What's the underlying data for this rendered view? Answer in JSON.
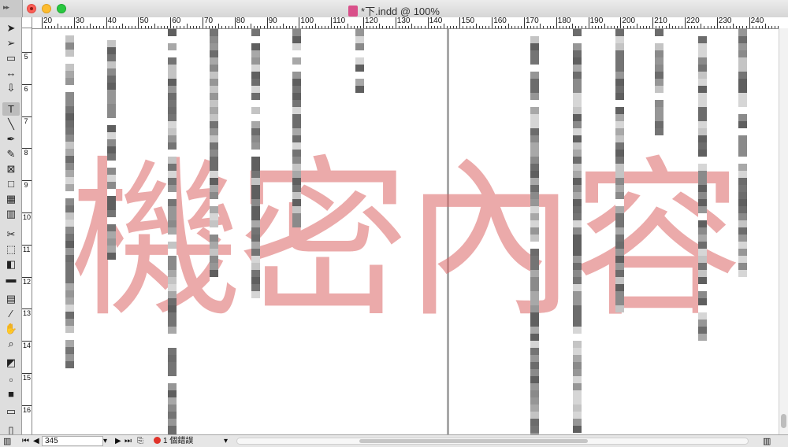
{
  "window": {
    "title": "*下.indd @ 100%",
    "buttons": [
      "close",
      "minimize",
      "zoom"
    ]
  },
  "colors": {
    "watermark": "#db6464",
    "close": "#fc5f57",
    "minimize": "#fdbc2f",
    "zoom": "#29c840",
    "preflight_error": "#e0332a"
  },
  "ruler": {
    "horizontal_labels": [
      "20",
      "30",
      "40",
      "50",
      "60",
      "70",
      "80",
      "90",
      "100",
      "110",
      "120",
      "130",
      "140",
      "150",
      "160",
      "170",
      "180",
      "190",
      "200",
      "210",
      "220",
      "230",
      "240"
    ],
    "vertical_labels": [
      "5",
      "6",
      "7",
      "8",
      "9",
      "10",
      "11",
      "12",
      "13",
      "14",
      "15",
      "16"
    ]
  },
  "toolbox": {
    "tools": [
      {
        "name": "selection-tool",
        "glyph": "➤"
      },
      {
        "name": "direct-selection-tool",
        "glyph": "➢"
      },
      {
        "name": "page-tool",
        "glyph": "▭"
      },
      {
        "name": "gap-tool",
        "glyph": "↔"
      },
      {
        "name": "content-collector-tool",
        "glyph": "⇩"
      },
      {
        "name": "type-tool",
        "glyph": "T"
      },
      {
        "name": "line-tool",
        "glyph": "╲"
      },
      {
        "name": "pen-tool",
        "glyph": "✒"
      },
      {
        "name": "pencil-tool",
        "glyph": "✎"
      },
      {
        "name": "rectangle-frame-tool",
        "glyph": "⊠"
      },
      {
        "name": "rectangle-tool",
        "glyph": "□"
      },
      {
        "name": "table-tool",
        "glyph": "▦"
      },
      {
        "name": "grid-tool",
        "glyph": "▥"
      },
      {
        "name": "scissors-tool",
        "glyph": "✂"
      },
      {
        "name": "free-transform-tool",
        "glyph": "⬚"
      },
      {
        "name": "gradient-swatch-tool",
        "glyph": "◧"
      },
      {
        "name": "gradient-feather-tool",
        "glyph": "▬"
      },
      {
        "name": "note-tool",
        "glyph": "▤"
      },
      {
        "name": "eyedropper-tool",
        "glyph": "⁄"
      },
      {
        "name": "hand-tool",
        "glyph": "✋"
      },
      {
        "name": "zoom-tool",
        "glyph": "⌕"
      }
    ]
  },
  "document": {
    "watermark_text": "機密內容"
  },
  "statusbar": {
    "page_number": "345",
    "errors_label": "1 個錯誤"
  }
}
